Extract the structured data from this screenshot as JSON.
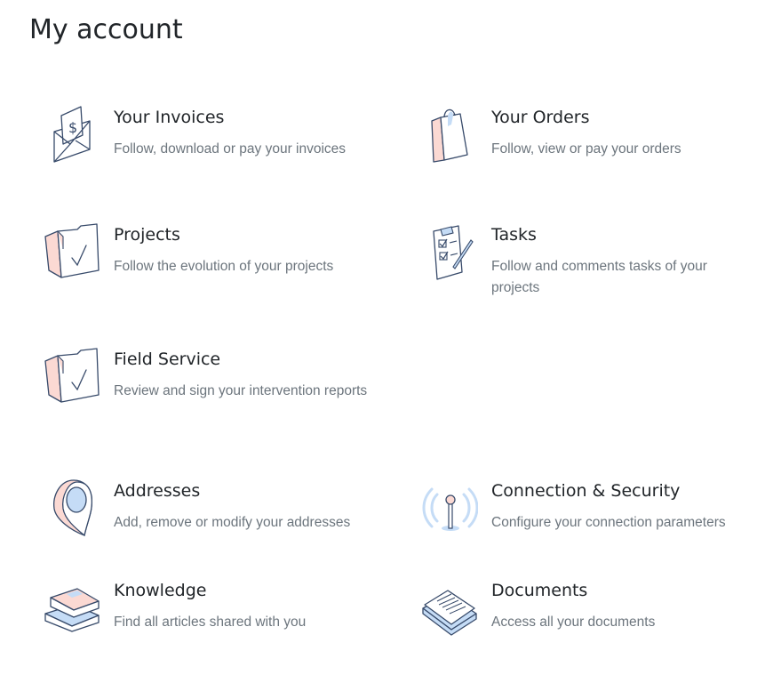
{
  "page": {
    "title": "My account"
  },
  "cards": {
    "invoices": {
      "label": "Your Invoices",
      "description": "Follow, download or pay your invoices",
      "icon": "envelope-dollar-icon"
    },
    "orders": {
      "label": "Your Orders",
      "description": "Follow, view or pay your orders",
      "icon": "shopping-bag-icon"
    },
    "projects": {
      "label": "Projects",
      "description": "Follow the evolution of your projects",
      "icon": "folder-check-icon"
    },
    "tasks": {
      "label": "Tasks",
      "description": "Follow and comments tasks of your projects",
      "icon": "clipboard-checklist-icon"
    },
    "field_service": {
      "label": "Field Service",
      "description": "Review and sign your intervention reports",
      "icon": "folder-check-icon"
    },
    "addresses": {
      "label": "Addresses",
      "description": "Add, remove or modify your addresses",
      "icon": "map-pin-icon"
    },
    "security": {
      "label": "Connection & Security",
      "description": "Configure your connection parameters",
      "icon": "antenna-signal-icon"
    },
    "knowledge": {
      "label": "Knowledge",
      "description": "Find all articles shared with you",
      "icon": "book-stack-icon"
    },
    "documents": {
      "label": "Documents",
      "description": "Access all your documents",
      "icon": "document-stack-icon"
    }
  },
  "colors": {
    "outline": "#374a6a",
    "pink": "#fbd9d3",
    "blue": "#c5dcf6",
    "text": "#212529",
    "muted": "#6c757d"
  }
}
